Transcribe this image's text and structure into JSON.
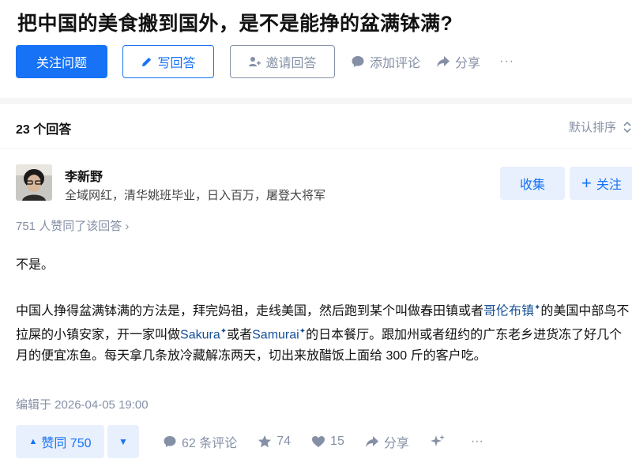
{
  "question": {
    "title": "把中国的美食搬到国外，是不是能挣的盆满钵满?",
    "actions": {
      "follow_question": "关注问题",
      "write_answer": "写回答",
      "invite_answer": "邀请回答",
      "add_comment": "添加评论",
      "share": "分享",
      "more": "···"
    }
  },
  "answers_header": {
    "count": "23 个回答",
    "sort": "默认排序"
  },
  "answer": {
    "author": {
      "name": "李新野",
      "bio": "全域网红，清华姚班毕业，日入百万，屠登大将军"
    },
    "collect_label": "收集",
    "follow_label": "关注",
    "vote_summary": "751 人赞同了该回答 ›",
    "paragraph1": "不是。",
    "paragraph2": {
      "t1": "中国人挣得盆满钵满的方法是，拜完妈祖，走线美国，然后跑到某个叫做春田镇或者",
      "link1": "哥伦布镇",
      "t2": "的美国中部鸟不拉屎的小镇安家，开一家叫做",
      "link2": "Sakura",
      "t3": "或者",
      "link3": "Samurai",
      "t4": "的日本餐厅。跟加州或者纽约的广东老乡进货冻了好几个月的便宜冻鱼。每天拿几条放冷藏解冻两天，切出来放醋饭上面给 300 斤的客户吃。",
      "spark": "✦"
    },
    "edit_time": "编辑于 2026-04-05 19:00",
    "bottom": {
      "upvote": "赞同 750",
      "upvote_arrow": "▲",
      "downvote_arrow": "▼",
      "comments": "62 条评论",
      "favorites": "74",
      "likes": "15",
      "share": "分享",
      "more": "···"
    }
  },
  "colors": {
    "brand_blue": "#1772f6",
    "muted_gray": "#8590a6",
    "light_blue_bg": "#e8f0fd",
    "link_blue": "#175199"
  }
}
